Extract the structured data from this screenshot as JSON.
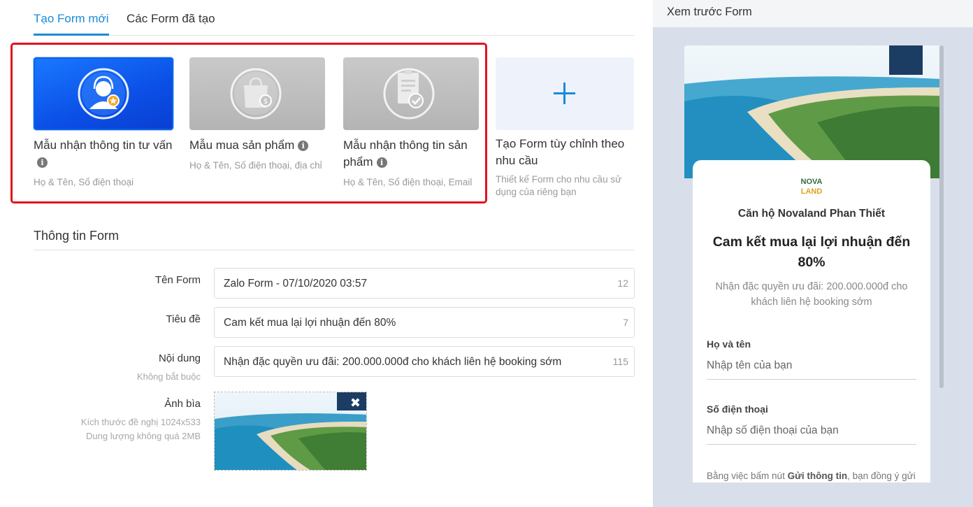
{
  "tabs": [
    {
      "label": "Tạo Form mới",
      "active": true
    },
    {
      "label": "Các Form đã tạo",
      "active": false
    }
  ],
  "templates": [
    {
      "title": "Mẫu nhận thông tin tư vấn",
      "fields": "Họ & Tên, Số điện thoại",
      "icon": "consultant-icon",
      "selected": true
    },
    {
      "title": "Mẫu mua sản phẩm",
      "fields": "Họ & Tên, Số điện thoại, địa chỉ",
      "icon": "shopping-bag-icon",
      "selected": false
    },
    {
      "title": "Mẫu nhận thông tin sản phẩm",
      "fields": "Họ & Tên, Số điện thoại, Email",
      "icon": "clipboard-check-icon",
      "selected": false
    },
    {
      "title": "Tạo Form tùy chỉnh theo nhu cầu",
      "fields": "Thiết kế Form cho nhu cầu sử dụng của riêng bạn",
      "icon": "plus-icon",
      "selected": false
    }
  ],
  "form_info": {
    "section_title": "Thông tin Form",
    "name_label": "Tên Form",
    "name_value": "Zalo Form - 07/10/2020 03:57",
    "name_count": "12",
    "title_label": "Tiêu đề",
    "title_value": "Cam kết mua lại lợi nhuận đến 80%",
    "title_count": "7",
    "content_label": "Nội dung",
    "content_hint": "Không bắt buộc",
    "content_value": "Nhận đặc quyền ưu đãi: 200.000.000đ cho khách liên hệ booking sớm",
    "content_count": "115",
    "cover_label": "Ảnh bìa",
    "cover_hint_1": "Kích thước đề nghị 1024x533",
    "cover_hint_2": "Dung lượng không quá 2MB",
    "cover_remove": "✖"
  },
  "preview": {
    "header": "Xem trước Form",
    "logo_top": "NOVA",
    "logo_bottom": "LAND",
    "company": "Căn hộ Novaland Phan Thiết",
    "headline": "Cam kết mua lại lợi nhuận đến 80%",
    "description": "Nhận đặc quyền ưu đãi: 200.000.000đ cho khách liên hệ booking sớm",
    "field1_label": "Họ và tên",
    "field1_placeholder": "Nhập tên của bạn",
    "field2_label": "Số điện thoại",
    "field2_placeholder": "Nhập số điện thoại của bạn",
    "terms_prefix": "Bằng việc bấm nút ",
    "terms_bold": "Gửi thông tin",
    "terms_suffix": ", bạn đồng ý gửi"
  },
  "colors": {
    "accent": "#1b8ad8",
    "highlight_frame": "#e0141e",
    "preview_bg": "#d8dfea"
  }
}
